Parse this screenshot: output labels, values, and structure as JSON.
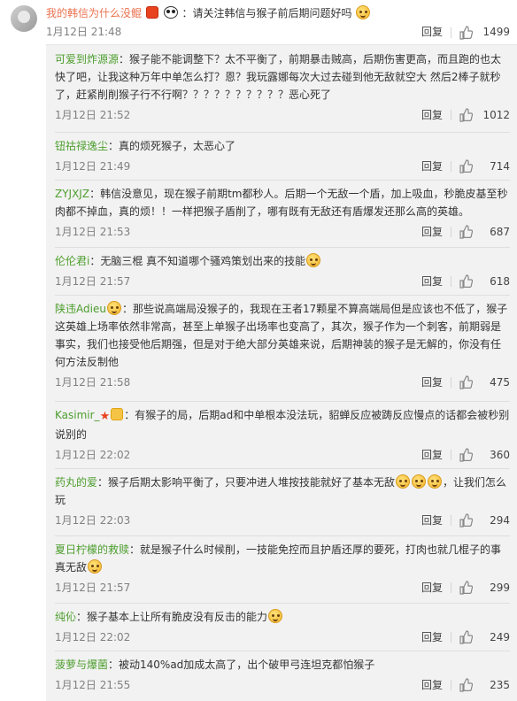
{
  "main": {
    "user": "我的韩信为什么没鲲",
    "text": "：请关注韩信与猴子前后期问题好吗",
    "time": "1月12日 21:48",
    "reply_label": "回复",
    "likes": "1499"
  },
  "replies": [
    {
      "user": "可爱到炸源源",
      "text": "：猴子能不能调整下？太不平衡了，前期暴击贼高，后期伤害更高，而且跑的也太快了吧，让我这种万年中单怎么打？恩？我玩露娜每次大过去碰到他无敌就空大 然后2棒子就秒了，赶紧削削猴子行不行啊？？？？？？？？？？恶心死了",
      "time": "1月12日 21:52",
      "reply_label": "回复",
      "likes": "1012"
    },
    {
      "user": "钮祜禄逸尘",
      "text": "：真的烦死猴子，太恶心了",
      "time": "1月12日 21:49",
      "reply_label": "回复",
      "likes": "714"
    },
    {
      "user": "ZYJXJZ",
      "text": "：韩信没意见，现在猴子前期tm都秒人。后期一个无敌一个盾，加上吸血，秒脆皮基至秒肉都不掉血，真的烦！！一样把猴子盾削了，哪有既有无敌还有盾爆发还那么高的英雄。",
      "time": "1月12日 21:53",
      "reply_label": "回复",
      "likes": "687"
    },
    {
      "user": "伦伦君i",
      "text": "：无脑三棍 真不知道哪个骚鸡策划出来的技能",
      "time": "1月12日 21:57",
      "reply_label": "回复",
      "likes": "618"
    },
    {
      "user": "陕违Adieu",
      "text": "：那些说高端局没猴子的，我现在王者17颗星不算高端局但是应该也不低了，猴子这英雄上场率依然非常高，甚至上单猴子出场率也变高了，其次，猴子作为一个刺客，前期弱是事实，我们也接受他后期强，但是对于绝大部分英雄来说，后期神装的猴子是无解的，你没有任何方法反制他",
      "time": "1月12日 21:58",
      "reply_label": "回复",
      "likes": "475"
    },
    {
      "user": "Kasimir_",
      "text": "：有猴子的局，后期ad和中单根本没法玩，貂蝉反应被踌反应慢点的话都会被秒别说别的",
      "time": "1月12日 22:02",
      "reply_label": "回复",
      "likes": "360"
    },
    {
      "user": "药丸的爱",
      "text": "：猴子后期太影响平衡了，只要冲进人堆按技能就好了基本无敌",
      "text2": "，让我们怎么玩",
      "time": "1月12日 22:03",
      "reply_label": "回复",
      "likes": "294"
    },
    {
      "user": "夏日柠檬的救赎",
      "text": "：就是猴子什么时候削，一技能免控而且护盾还厚的要死，打肉也就几棍子的事真无敌",
      "time": "1月12日 21:57",
      "reply_label": "回复",
      "likes": "299"
    },
    {
      "user": "纯伈",
      "text": "：猴子基本上让所有脆皮没有反击的能力",
      "time": "1月12日 22:02",
      "reply_label": "回复",
      "likes": "249"
    },
    {
      "user": "菠萝与爆菌",
      "text": "：被动140%ad加成太高了，出个破甲弓连坦克都怕猴子",
      "time": "1月12日 21:55",
      "reply_label": "回复",
      "likes": "235"
    }
  ],
  "colors": {
    "username": "#eb7350",
    "reply_bg": "#f2f2f2",
    "meta": "#808080",
    "username_reply": "#4d9e2e"
  }
}
